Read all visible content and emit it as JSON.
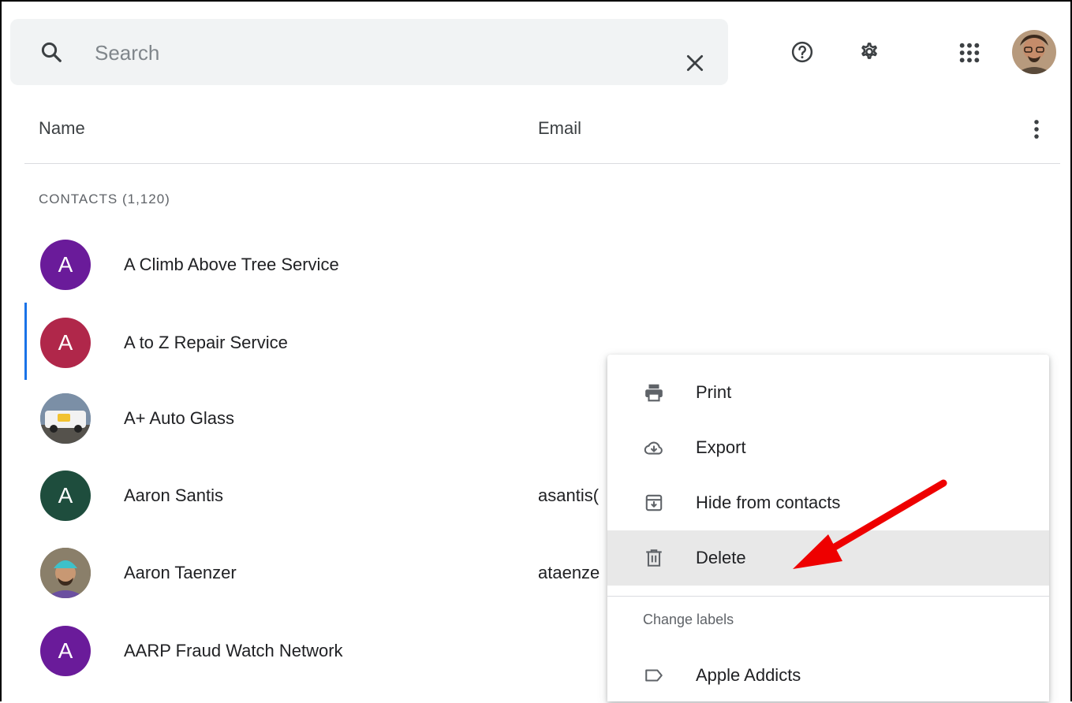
{
  "search": {
    "placeholder": "Search"
  },
  "header": {
    "name_col": "Name",
    "email_col": "Email"
  },
  "section": {
    "label": "CONTACTS (1,120)"
  },
  "contacts": [
    {
      "initial": "A",
      "name": "A Climb Above Tree Service",
      "email": "",
      "color": "#6a1b9a"
    },
    {
      "initial": "A",
      "name": "A to Z Repair Service",
      "email": "",
      "color": "#b0274a"
    },
    {
      "initial": "",
      "name": "A+ Auto Glass",
      "email": "",
      "color": "#4f6f8f"
    },
    {
      "initial": "A",
      "name": "Aaron Santis",
      "email": "asantis(",
      "color": "#1e4d3d"
    },
    {
      "initial": "",
      "name": "Aaron Taenzer",
      "email": "ataenze",
      "color": "#7a6d5a"
    },
    {
      "initial": "A",
      "name": "AARP Fraud Watch Network",
      "email": "",
      "color": "#6a1b9a"
    }
  ],
  "menu": {
    "items": [
      {
        "label": "Print",
        "icon": "printer-icon"
      },
      {
        "label": "Export",
        "icon": "cloud-download-icon"
      },
      {
        "label": "Hide from contacts",
        "icon": "archive-icon"
      },
      {
        "label": "Delete",
        "icon": "trash-icon"
      }
    ],
    "subheader": "Change labels",
    "labels": [
      {
        "label": "Apple Addicts",
        "icon": "label-icon"
      }
    ]
  },
  "colors": {
    "accent": "#1a73e8",
    "arrow": "#ee0000"
  }
}
